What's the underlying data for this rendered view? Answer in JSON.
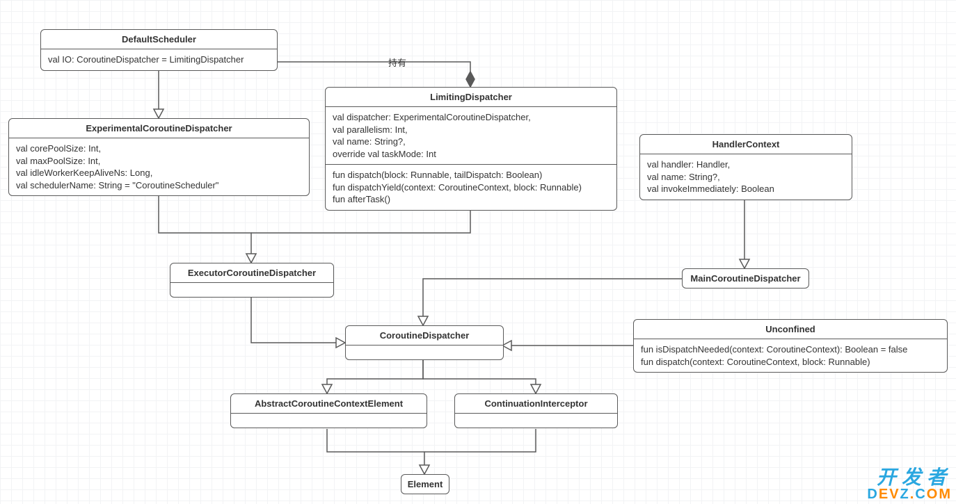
{
  "nodes": {
    "defaultScheduler": {
      "title": "DefaultScheduler",
      "attrs": "val IO: CoroutineDispatcher = LimitingDispatcher"
    },
    "experimental": {
      "title": "ExperimentalCoroutineDispatcher",
      "attrs": "val corePoolSize: Int,\nval maxPoolSize: Int,\nval idleWorkerKeepAliveNs: Long,\nval schedulerName: String = \"CoroutineScheduler\""
    },
    "limiting": {
      "title": "LimitingDispatcher",
      "attrs": "val dispatcher: ExperimentalCoroutineDispatcher,\nval parallelism: Int,\nval name: String?,\noverride val taskMode: Int",
      "ops": "fun dispatch(block: Runnable, tailDispatch: Boolean)\nfun dispatchYield(context: CoroutineContext, block: Runnable)\nfun afterTask()"
    },
    "handlerContext": {
      "title": "HandlerContext",
      "attrs": "val handler: Handler,\nval name: String?,\nval invokeImmediately: Boolean"
    },
    "executor": {
      "title": "ExecutorCoroutineDispatcher"
    },
    "mainDispatcher": {
      "title": "MainCoroutineDispatcher"
    },
    "coroutineDispatcher": {
      "title": "CoroutineDispatcher"
    },
    "unconfined": {
      "title": "Unconfined",
      "attrs": "fun isDispatchNeeded(context: CoroutineContext): Boolean = false\nfun dispatch(context: CoroutineContext, block: Runnable)"
    },
    "abstractElement": {
      "title": "AbstractCoroutineContextElement"
    },
    "continuationInterceptor": {
      "title": "ContinuationInterceptor"
    },
    "element": {
      "title": "Element"
    }
  },
  "labels": {
    "has": "持有"
  },
  "watermark": {
    "cn": "开发者",
    "en_pre": "D",
    "en_mid1": "EV",
    "en_mid2": "Z",
    "en_dot": ".",
    "en_c": "C",
    "en_om": "OM"
  }
}
